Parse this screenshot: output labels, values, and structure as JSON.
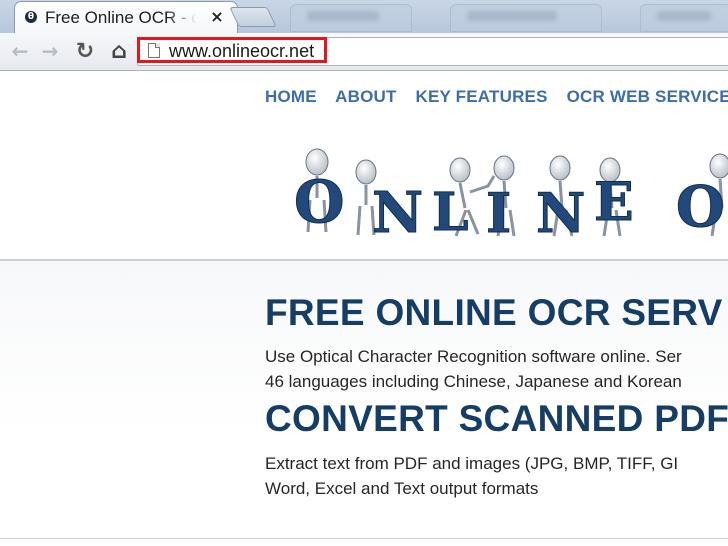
{
  "browser": {
    "tab": {
      "title": "Free Online OCR - cc",
      "favicon": "onlineocr-favicon",
      "close": "×"
    },
    "toolbar": {
      "back_icon": "←",
      "forward_icon": "→",
      "reload_icon": "↻",
      "home_icon": "⌂"
    },
    "address": {
      "url": "www.onlineocr.net",
      "highlight_color": "#e5161c"
    }
  },
  "nav": {
    "items": [
      {
        "label": "HOME"
      },
      {
        "label": "ABOUT"
      },
      {
        "label": "KEY FEATURES"
      },
      {
        "label": "OCR WEB SERVICE"
      }
    ]
  },
  "logo": {
    "letters": [
      "O",
      "N",
      "L",
      "I",
      "N",
      "E",
      "O"
    ],
    "color": "#23497a"
  },
  "main": {
    "heading1": "FREE ONLINE OCR SERV",
    "para1_line1": "Use Optical Character Recognition software online. Ser",
    "para1_line2": "46 languages including Chinese, Japanese and Korean",
    "heading2": "CONVERT SCANNED PDF",
    "para2_line1": "Extract text from PDF and images (JPG, BMP, TIFF, GI",
    "para2_line2": "Word, Excel and Text output formats"
  }
}
